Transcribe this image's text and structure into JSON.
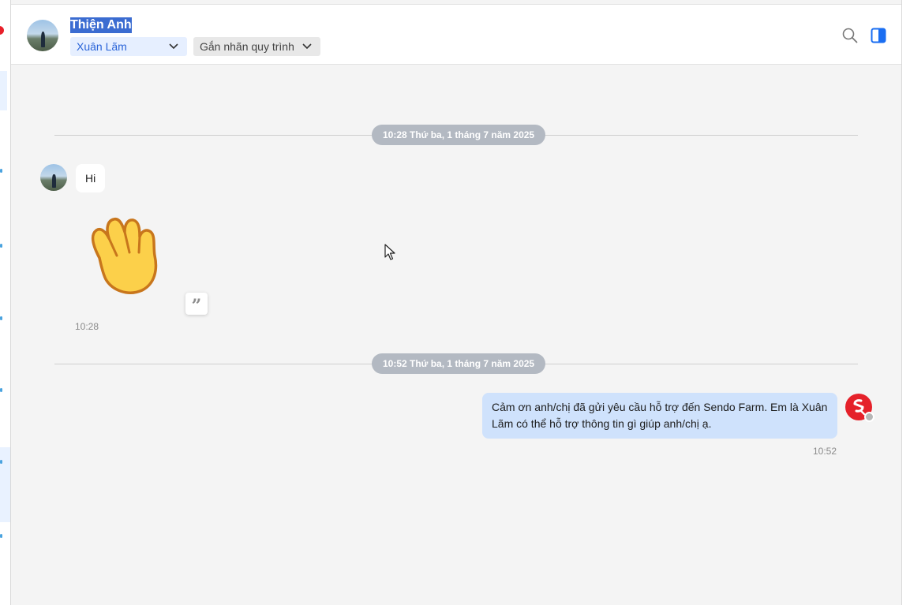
{
  "header": {
    "contact_name": "Thiện Anh",
    "assignee": "Xuân Lãm",
    "label_dropdown": "Gắn nhãn quy trình"
  },
  "messages": {
    "date_divider_1": "10:28 Thứ ba, 1 tháng 7 năm 2025",
    "incoming_text": "Hi",
    "incoming_time": "10:28",
    "date_divider_2": "10:52 Thứ ba, 1 tháng 7 năm 2025",
    "outgoing_text": "Cảm ơn anh/chị đã gửi yêu cầu hỗ trợ đến Sendo Farm. Em là Xuân Lãm có thể hỗ trợ thông tin gì giúp anh/chị ạ.",
    "outgoing_time": "10:52"
  },
  "icons": {
    "search": "search-icon",
    "panel": "side-panel-icon",
    "quote": "quote-icon",
    "sticker": "waving-hand-sticker"
  },
  "colors": {
    "accent": "#2a64d8",
    "outgoing_bubble": "#cfe2fc",
    "date_pill": "#b3b9c2",
    "brand_red": "#e5212a"
  }
}
